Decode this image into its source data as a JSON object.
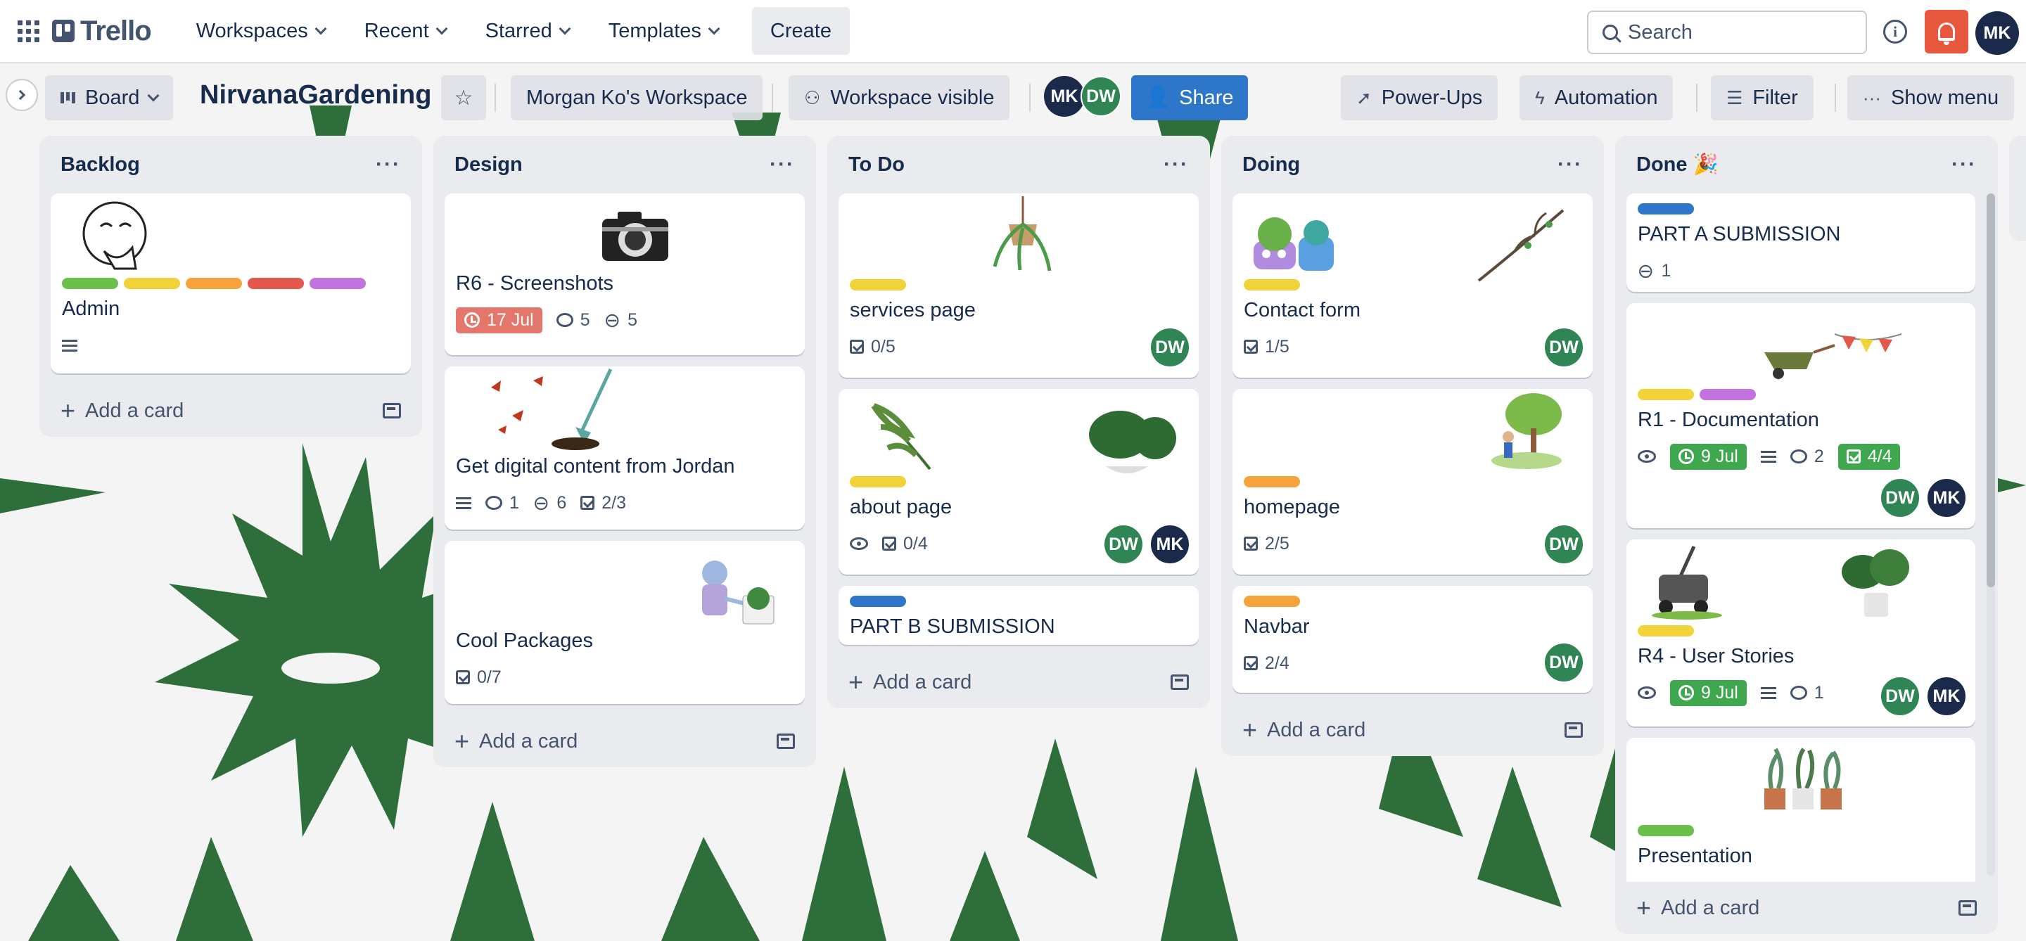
{
  "topnav": {
    "logo": "Trello",
    "menus": [
      "Workspaces",
      "Recent",
      "Starred",
      "Templates"
    ],
    "create": "Create",
    "search_placeholder": "Search",
    "user_initials": "MK"
  },
  "board": {
    "view": "Board",
    "title": "NirvanaGardening",
    "workspace": "Morgan Ko's Workspace",
    "visibility": "Workspace visible",
    "members": [
      "MK",
      "DW"
    ],
    "share": "Share",
    "power_ups": "Power-Ups",
    "automation": "Automation",
    "filter": "Filter",
    "show_menu": "Show menu"
  },
  "colors": {
    "background_leaf": "#2d6e3a",
    "green_label": "#6cc04a",
    "yellow_label": "#f0d43a",
    "orange_label": "#f5a33a",
    "red_label": "#e2584a",
    "purple_label": "#c273e0",
    "blue_label": "#2d76c9",
    "due_overdue": "#e4766b",
    "due_complete": "#3fa84f"
  },
  "lists": [
    {
      "title": "Backlog",
      "add": "Add a card",
      "cards": [
        {
          "title": "Admin",
          "labels": [
            "green",
            "yellow",
            "orange",
            "red",
            "purple"
          ],
          "image": "thinking-face-sketch",
          "badges": {
            "description": true
          }
        }
      ]
    },
    {
      "title": "Design",
      "add": "Add a card",
      "cards": [
        {
          "title": "R6 - Screenshots",
          "image": "camera",
          "badges": {
            "due": "17 Jul",
            "comments": "5",
            "attachments": "5"
          }
        },
        {
          "title": "Get digital content from Jordan",
          "image": "butterflies-and-shovel",
          "badges": {
            "description": true,
            "comments": "1",
            "attachments": "6",
            "checklist": "2/3"
          }
        },
        {
          "title": "Cool Packages",
          "image": "robot-with-plant",
          "badges": {
            "checklist": "0/7"
          }
        }
      ]
    },
    {
      "title": "To Do",
      "add": "Add a card",
      "cards": [
        {
          "title": "services page",
          "labels": [
            "yellow"
          ],
          "image": "hanging-plant",
          "badges": {
            "checklist": "0/5"
          },
          "members": [
            "DW"
          ]
        },
        {
          "title": "about page",
          "labels": [
            "yellow"
          ],
          "image": "palm-and-monstera",
          "badges": {
            "watching": true,
            "checklist": "0/4"
          },
          "members": [
            "DW",
            "MK"
          ]
        },
        {
          "title": "PART B SUBMISSION",
          "labels": [
            "blue"
          ]
        }
      ]
    },
    {
      "title": "Doing",
      "add": "Add a card",
      "cards": [
        {
          "title": "Contact form",
          "labels": [
            "yellow"
          ],
          "image": "succulents-and-branch",
          "badges": {
            "checklist": "1/5"
          },
          "members": [
            "DW"
          ]
        },
        {
          "title": "homepage",
          "labels": [
            "orange"
          ],
          "image": "gardener-tree",
          "badges": {
            "checklist": "2/5"
          },
          "members": [
            "DW"
          ]
        },
        {
          "title": "Navbar",
          "labels": [
            "orange"
          ],
          "badges": {
            "checklist": "2/4"
          },
          "members": [
            "DW"
          ]
        }
      ]
    },
    {
      "title": "Done 🎉",
      "add": "Add a card",
      "cards": [
        {
          "title": "PART A SUBMISSION",
          "labels": [
            "blue"
          ],
          "badges": {
            "attachments": "1"
          }
        },
        {
          "title": "R1 - Documentation",
          "labels": [
            "yellow",
            "purple"
          ],
          "image": "wheelbarrow-and-bunting",
          "badges": {
            "watching": true,
            "due": "9 Jul",
            "description": true,
            "comments": "2",
            "checklist": "4/4"
          },
          "members": [
            "DW",
            "MK"
          ]
        },
        {
          "title": "R4 - User Stories",
          "labels": [
            "yellow"
          ],
          "image": "lawnmower-and-monstera",
          "badges": {
            "watching": true,
            "due": "9 Jul",
            "description": true,
            "comments": "1"
          },
          "members": [
            "DW",
            "MK"
          ]
        },
        {
          "title": "Presentation",
          "labels": [
            "green"
          ],
          "image": "potted-plants"
        }
      ]
    }
  ]
}
